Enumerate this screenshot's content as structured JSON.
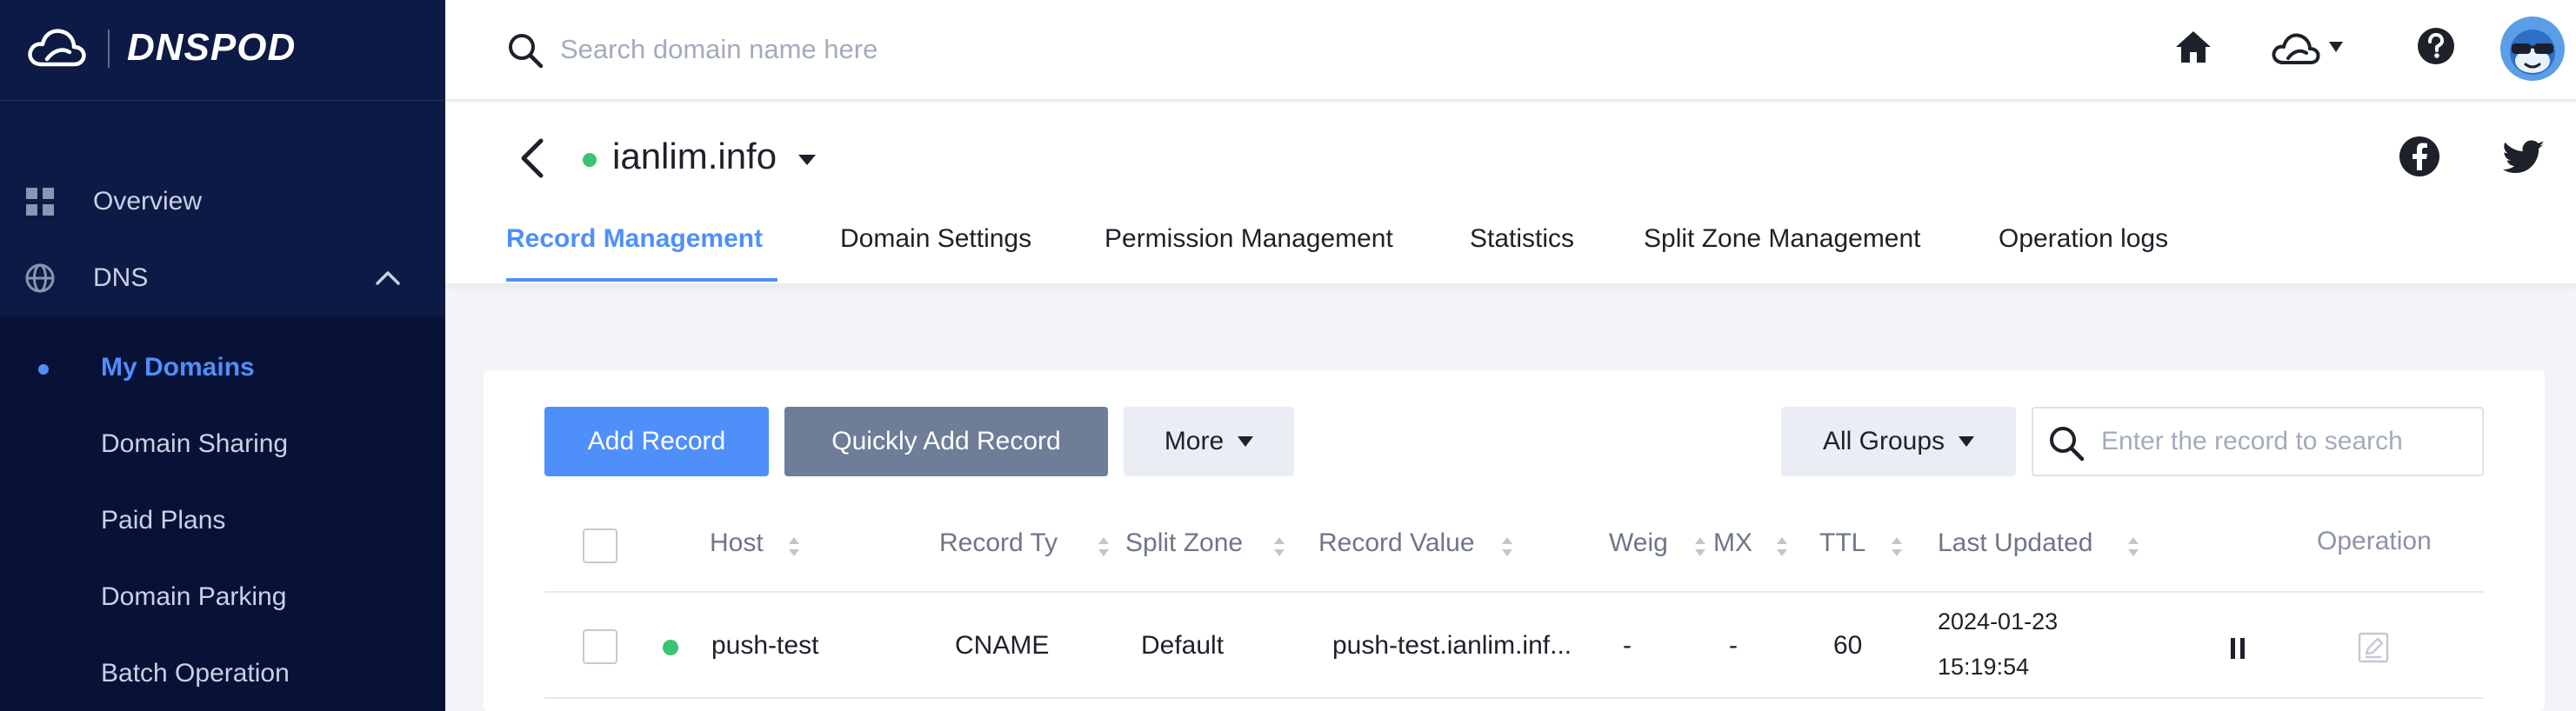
{
  "brand": {
    "name": "DNSPOD"
  },
  "header": {
    "search_placeholder": "Search domain name here"
  },
  "sidebar": {
    "items": [
      {
        "label": "Overview"
      },
      {
        "label": "DNS"
      }
    ],
    "sub_items": [
      {
        "label": "My Domains",
        "active": true
      },
      {
        "label": "Domain Sharing"
      },
      {
        "label": "Paid Plans"
      },
      {
        "label": "Domain Parking"
      },
      {
        "label": "Batch Operation"
      }
    ]
  },
  "domain": {
    "name": "ianlim.info",
    "status_color": "#3cc270"
  },
  "tabs": [
    {
      "label": "Record Management",
      "active": true
    },
    {
      "label": "Domain Settings"
    },
    {
      "label": "Permission Management"
    },
    {
      "label": "Statistics"
    },
    {
      "label": "Split Zone Management"
    },
    {
      "label": "Operation logs"
    }
  ],
  "toolbar": {
    "add_record": "Add Record",
    "quick_add": "Quickly Add Record",
    "more": "More",
    "groups": "All Groups",
    "search_placeholder": "Enter the record to search"
  },
  "table": {
    "columns": [
      "Host",
      "Record Ty",
      "Split Zone",
      "Record Value",
      "Weig",
      "MX",
      "TTL",
      "Last Updated",
      "Operation"
    ],
    "rows": [
      {
        "host": "push-test",
        "record_type": "CNAME",
        "split_zone": "Default",
        "record_value": "push-test.ianlim.inf...",
        "weight": "-",
        "mx": "-",
        "ttl": "60",
        "updated_date": "2024-01-23",
        "updated_time": "15:19:54"
      }
    ]
  },
  "colors": {
    "accent": "#4f8ffa",
    "sidebar_bg": "#0c1a45",
    "status_ok": "#3cc270"
  },
  "icons": [
    "cloud-logo-icon",
    "search-icon",
    "home-icon",
    "cloud-icon",
    "help-icon",
    "avatar",
    "back-icon",
    "facebook-icon",
    "twitter-icon",
    "overview-icon",
    "globe-icon",
    "chevron-up-icon",
    "pause-icon",
    "edit-icon"
  ]
}
